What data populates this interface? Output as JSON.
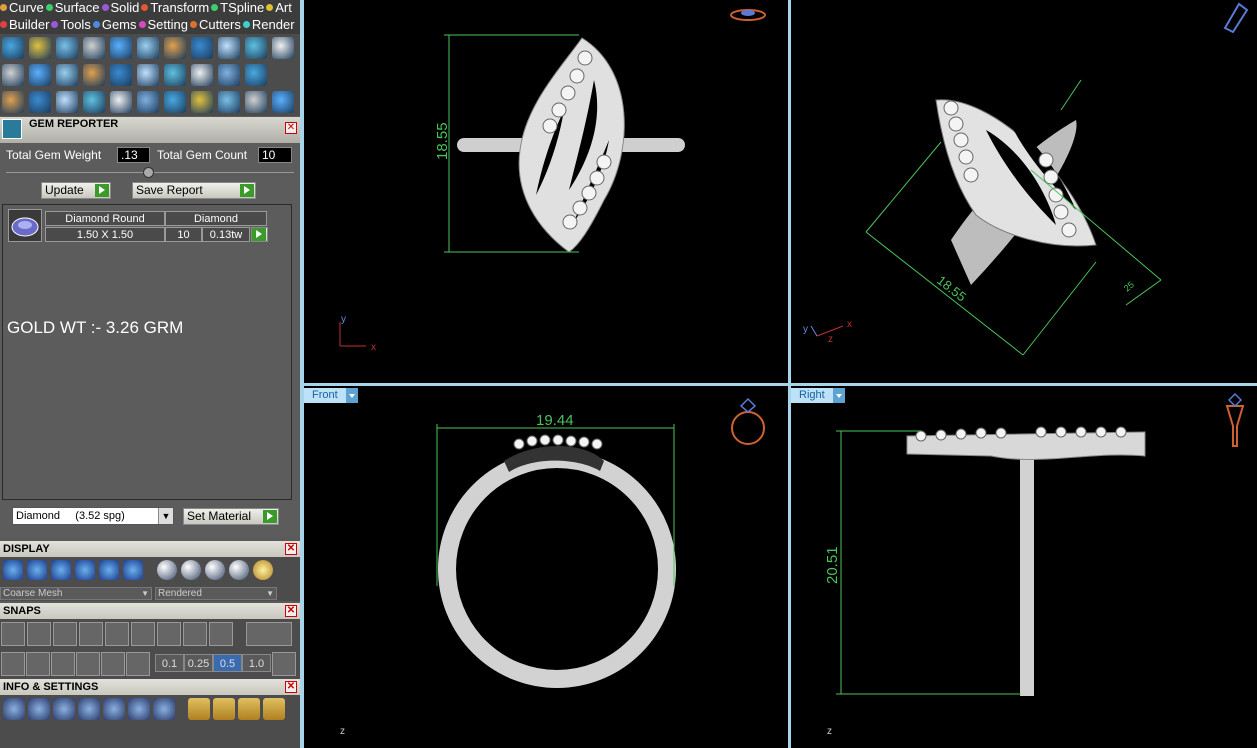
{
  "menu": {
    "row1": [
      {
        "label": "Curve",
        "color": "#e0a040"
      },
      {
        "label": "Surface",
        "color": "#3ad06a"
      },
      {
        "label": "Solid",
        "color": "#9a5ad8"
      },
      {
        "label": "Transform",
        "color": "#e05a30"
      },
      {
        "label": "TSpline",
        "color": "#3ad06a"
      },
      {
        "label": "Art",
        "color": "#e0c030"
      }
    ],
    "row2": [
      {
        "label": "Builder",
        "color": "#e04040"
      },
      {
        "label": "Tools",
        "color": "#9a5ad8"
      },
      {
        "label": "Gems",
        "color": "#4a8ae0"
      },
      {
        "label": "Setting",
        "color": "#d84ac0"
      },
      {
        "label": "Cutters",
        "color": "#e07030"
      },
      {
        "label": "Render",
        "color": "#3ad0d0"
      }
    ]
  },
  "gem_reporter": {
    "title": "GEM REPORTER",
    "total_weight_label": "Total Gem Weight",
    "total_weight_value": ".13",
    "total_count_label": "Total Gem Count",
    "total_count_value": "10",
    "update_label": "Update",
    "save_report_label": "Save Report",
    "table": {
      "col1_header": "Diamond Round",
      "col2_header": "Diamond",
      "size": "1.50 X 1.50",
      "count": "10",
      "weight": "0.13tw"
    },
    "note": "GOLD WT :- 3.26 GRM",
    "material_select": "Diamond     (3.52 spg)",
    "set_material_label": "Set Material"
  },
  "display": {
    "title": "DISPLAY",
    "mesh_select": "Coarse Mesh",
    "render_select": "Rendered"
  },
  "snaps": {
    "title": "SNAPS",
    "values": [
      "0.1",
      "0.25",
      "0.5",
      "1.0"
    ],
    "selected": "0.5"
  },
  "info": {
    "title": "INFO & SETTINGS"
  },
  "viewports": {
    "top_left": {
      "dimension": "18.55",
      "axis_y": "y",
      "axis_x": "x"
    },
    "top_right": {
      "dimension": "18.55",
      "dimension_small": "25",
      "axis_y": "y",
      "axis_z": "z",
      "axis_x": "x"
    },
    "bottom_left": {
      "label": "Front",
      "dimension": "19.44",
      "axis_z": "z"
    },
    "bottom_right": {
      "label": "Right",
      "dimension": "20.51",
      "axis_z": "z"
    }
  },
  "colors": {
    "viewport_border": "#a8d4ea",
    "dimension_line": "#4ac45a",
    "panel_bg": "#5a5a5a"
  }
}
